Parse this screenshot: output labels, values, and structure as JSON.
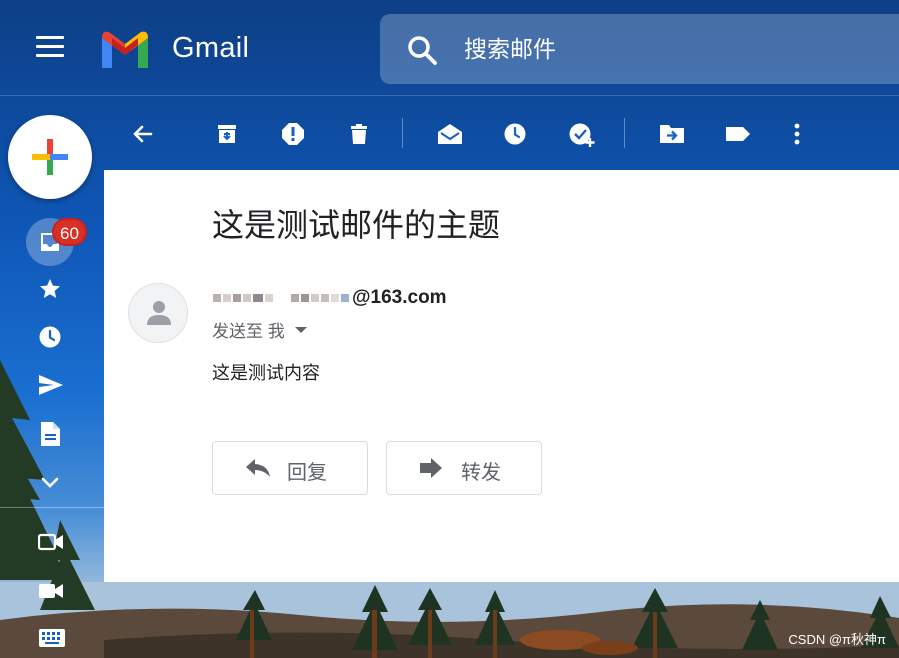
{
  "app": {
    "brand_name": "Gmail"
  },
  "search": {
    "placeholder": "搜索邮件"
  },
  "nav": {
    "inbox_unread_count": "60",
    "items": [
      "inbox",
      "starred",
      "snoozed",
      "sent",
      "drafts",
      "more",
      "meet",
      "video",
      "keyboard"
    ]
  },
  "toolbar": {
    "buttons": [
      "back",
      "archive",
      "report-spam",
      "delete",
      "mark-unread",
      "snooze",
      "add-to-tasks",
      "move-to",
      "labels",
      "more"
    ]
  },
  "message": {
    "subject": "这是测试邮件的主题",
    "sender_domain": "@163.com",
    "recipient_label": "发送至 我",
    "body": "这是测试内容"
  },
  "actions": {
    "reply_label": "回复",
    "forward_label": "转发"
  },
  "watermark": "CSDN @π秋神π",
  "colors": {
    "badge": "#d93025",
    "panel": "#ffffff",
    "sky_top": "#0d3f86",
    "sky_mid": "#1a6fd0"
  }
}
